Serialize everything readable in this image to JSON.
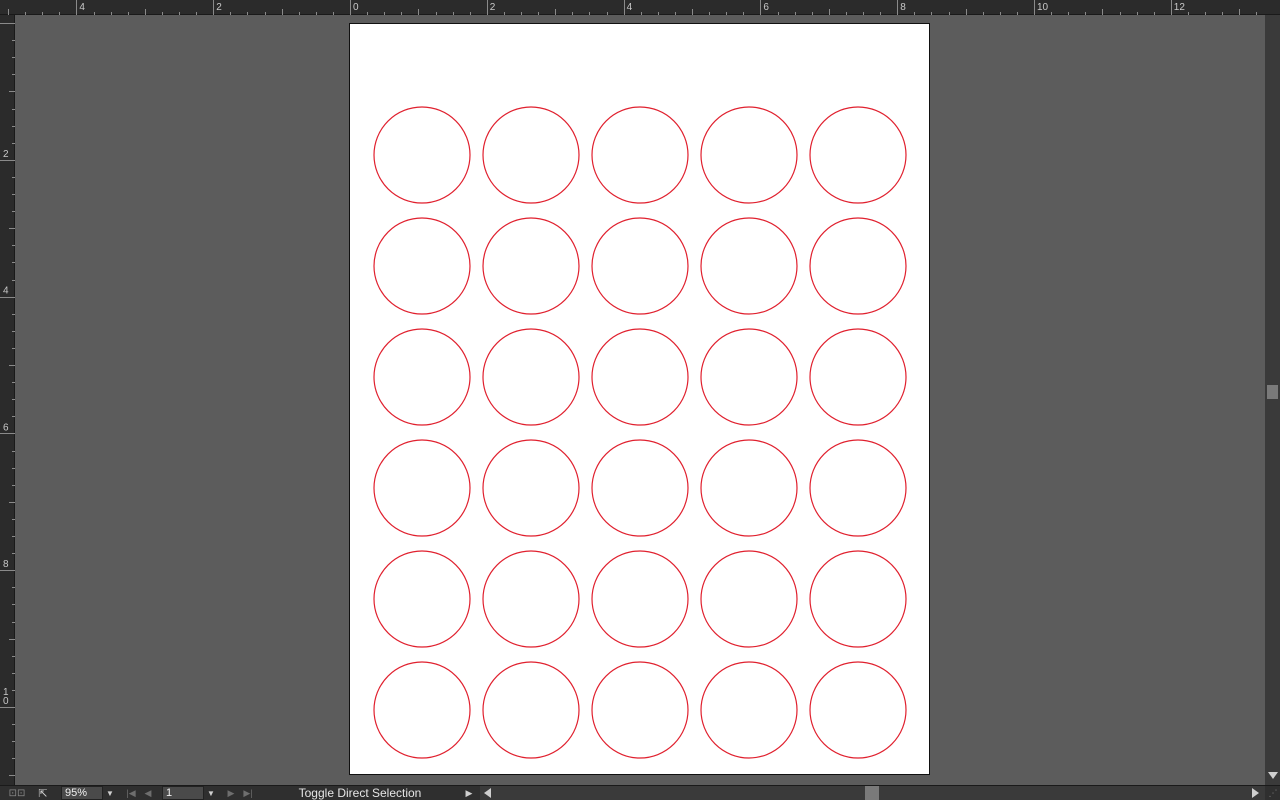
{
  "ruler": {
    "horizontal_labels": [
      "4",
      "2",
      "0",
      "2",
      "4",
      "6",
      "8",
      "10",
      "12"
    ],
    "vertical_labels": [
      "2",
      "4",
      "6",
      "8",
      "10"
    ]
  },
  "artboard": {
    "rows": 6,
    "columns": 5,
    "shape": "circle",
    "stroke_color": "#e0202e",
    "fill_color": "#ffffff"
  },
  "statusbar": {
    "zoom": "95%",
    "page": "1",
    "status_text": "Toggle Direct Selection"
  },
  "colors": {
    "workspace": "#5c5c5c",
    "artboard": "#ffffff",
    "circle_stroke": "#e0202e"
  }
}
